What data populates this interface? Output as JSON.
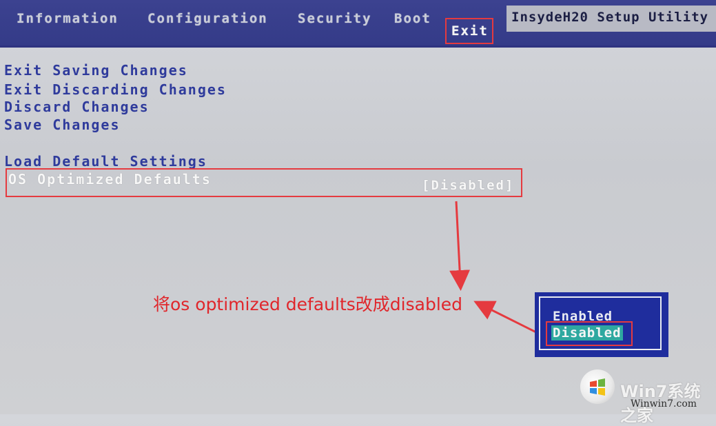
{
  "menubar": {
    "tabs": [
      {
        "label": "Information"
      },
      {
        "label": "Configuration"
      },
      {
        "label": "Security"
      },
      {
        "label": "Boot"
      },
      {
        "label": "Exit"
      }
    ],
    "brand": "InsydeH20 Setup Utility"
  },
  "exit_menu": {
    "items": [
      {
        "label": "Exit Saving Changes"
      },
      {
        "label": "Exit Discarding Changes"
      },
      {
        "label": "Discard Changes"
      },
      {
        "label": "Save Changes"
      },
      {
        "label": "Load Default Settings"
      },
      {
        "label": "OS Optimized Defaults",
        "value": "[Disabled]"
      }
    ]
  },
  "annotation": {
    "text": "将os optimized defaults改成disabled",
    "color": "#e0262b"
  },
  "popup": {
    "options": [
      "Enabled",
      "Disabled"
    ],
    "selected": "Disabled"
  },
  "watermark": {
    "site_name": "Win7系统之家",
    "url": "Winwin7.com"
  },
  "colors": {
    "menubar": "#3c4290",
    "item_text": "#2f3b9c",
    "highlight": "#e53a3f",
    "popup_bg": "#1f2d9d",
    "selection": "#2ea8a0"
  }
}
